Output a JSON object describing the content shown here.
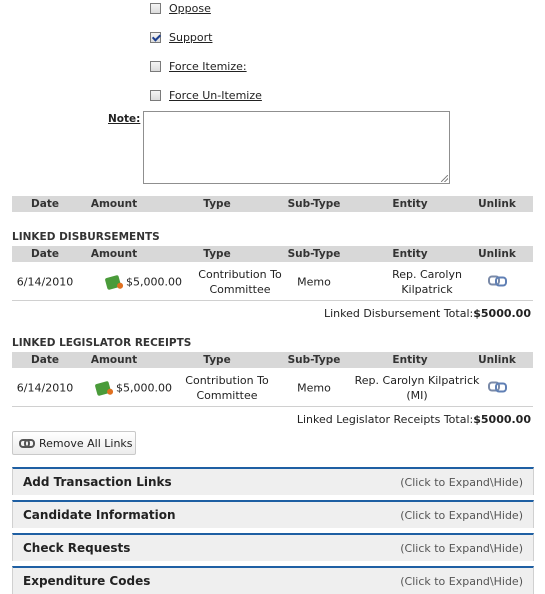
{
  "checkboxes": [
    {
      "label": "Oppose",
      "checked": false
    },
    {
      "label": "Support",
      "checked": true
    },
    {
      "label": "Force Itemize:",
      "checked": false
    },
    {
      "label": "Force Un-Itemize",
      "checked": false
    }
  ],
  "note": {
    "label": "Note:",
    "value": ""
  },
  "columns": {
    "date": "Date",
    "amount": "Amount",
    "type": "Type",
    "subtype": "Sub-Type",
    "entity": "Entity",
    "unlink": "Unlink"
  },
  "linked_disbursements": {
    "title": "LINKED DISBURSEMENTS",
    "rows": [
      {
        "date": "6/14/2010",
        "amount": "$5,000.00",
        "type": "Contribution To Committee",
        "subtype": "Memo",
        "entity": "Rep. Carolyn Kilpatrick"
      }
    ],
    "total_label": "Linked Disbursement Total:",
    "total_value": "$5000.00"
  },
  "linked_receipts": {
    "title": "LINKED LEGISLATOR RECEIPTS",
    "rows": [
      {
        "date": "6/14/2010",
        "amount": "$5,000.00",
        "type": "Contribution To Committee",
        "subtype": "Memo",
        "entity": "Rep. Carolyn Kilpatrick (MI)"
      }
    ],
    "total_label": "Linked Legislator Receipts Total:",
    "total_value": "$5000.00"
  },
  "remove_all_links": "Remove All Links",
  "expanders": [
    {
      "title": "Add Transaction Links",
      "hint": "(Click to Expand\\Hide)"
    },
    {
      "title": "Candidate Information",
      "hint": "(Click to Expand\\Hide)"
    },
    {
      "title": "Check Requests",
      "hint": "(Click to Expand\\Hide)"
    },
    {
      "title": "Expenditure Codes",
      "hint": "(Click to Expand\\Hide)"
    }
  ]
}
